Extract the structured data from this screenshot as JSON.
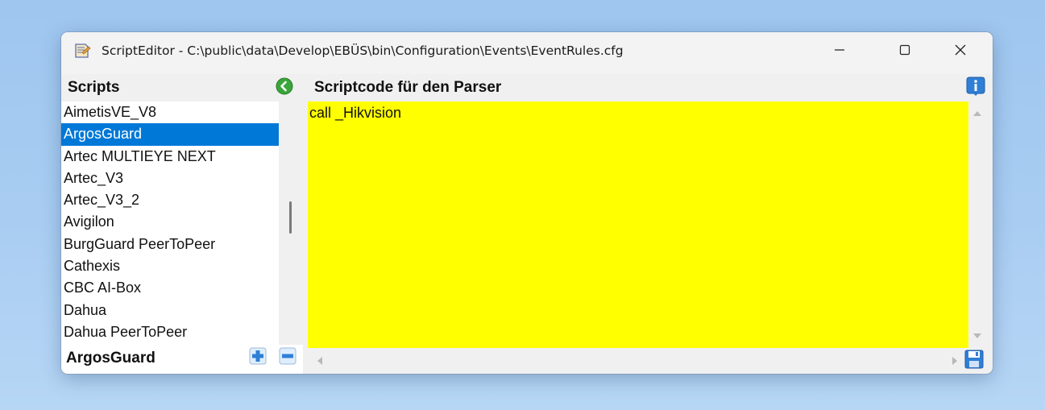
{
  "window": {
    "title": "ScriptEditor - C:\\public\\data\\Develop\\EBÜS\\bin\\Configuration\\Events\\EventRules.cfg"
  },
  "scripts_panel": {
    "header": "Scripts",
    "items": [
      {
        "label": "AimetisVE_V8",
        "selected": false
      },
      {
        "label": "ArgosGuard",
        "selected": true
      },
      {
        "label": "Artec MULTIEYE NEXT",
        "selected": false
      },
      {
        "label": "Artec_V3",
        "selected": false
      },
      {
        "label": "Artec_V3_2",
        "selected": false
      },
      {
        "label": "Avigilon",
        "selected": false
      },
      {
        "label": "BurgGuard PeerToPeer",
        "selected": false
      },
      {
        "label": "Cathexis",
        "selected": false
      },
      {
        "label": "CBC AI-Box",
        "selected": false
      },
      {
        "label": "Dahua",
        "selected": false
      },
      {
        "label": "Dahua PeerToPeer",
        "selected": false
      }
    ],
    "current_script": "ArgosGuard"
  },
  "editor": {
    "header": "Scriptcode für den Parser",
    "code": "call _Hikvision",
    "background_color": "#ffff00"
  },
  "colors": {
    "selection": "#0078d7",
    "icon_green": "#3aa63a",
    "icon_blue": "#2f7fd6"
  },
  "icons": [
    "app-script-icon",
    "back-arrow-icon",
    "info-icon",
    "add-icon",
    "remove-icon",
    "save-icon"
  ]
}
